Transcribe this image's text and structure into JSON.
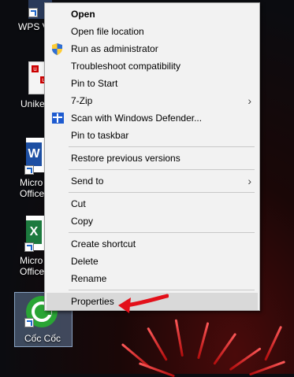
{
  "desktop": {
    "icons": [
      {
        "label": "WPS V",
        "icon": "wps-icon"
      },
      {
        "label": "Unike",
        "icon": "unikey-icon"
      },
      {
        "label": "Micro\nOffice",
        "icon": "word-icon"
      },
      {
        "label": "Micro\nOffice",
        "icon": "excel-icon"
      },
      {
        "label": "Cốc Cốc",
        "icon": "coccoc-icon"
      }
    ]
  },
  "context_menu": {
    "items": [
      {
        "label": "Open",
        "bold": true
      },
      {
        "label": "Open file location"
      },
      {
        "label": "Run as administrator",
        "icon": "shield-icon"
      },
      {
        "label": "Troubleshoot compatibility"
      },
      {
        "label": "Pin to Start"
      },
      {
        "label": "7-Zip",
        "submenu": true
      },
      {
        "label": "Scan with Windows Defender...",
        "icon": "defender-icon"
      },
      {
        "label": "Pin to taskbar"
      },
      {
        "label": "Restore previous versions"
      },
      {
        "label": "Send to",
        "submenu": true
      },
      {
        "label": "Cut"
      },
      {
        "label": "Copy"
      },
      {
        "label": "Create shortcut"
      },
      {
        "label": "Delete"
      },
      {
        "label": "Rename"
      },
      {
        "label": "Properties",
        "highlighted": true
      }
    ],
    "submenu_glyph": "›"
  },
  "colors": {
    "menu_bg": "#f2f2f2",
    "highlight": "#d9d9d9",
    "annotation_arrow": "#e3101a",
    "accent": "#1e5bd0"
  }
}
